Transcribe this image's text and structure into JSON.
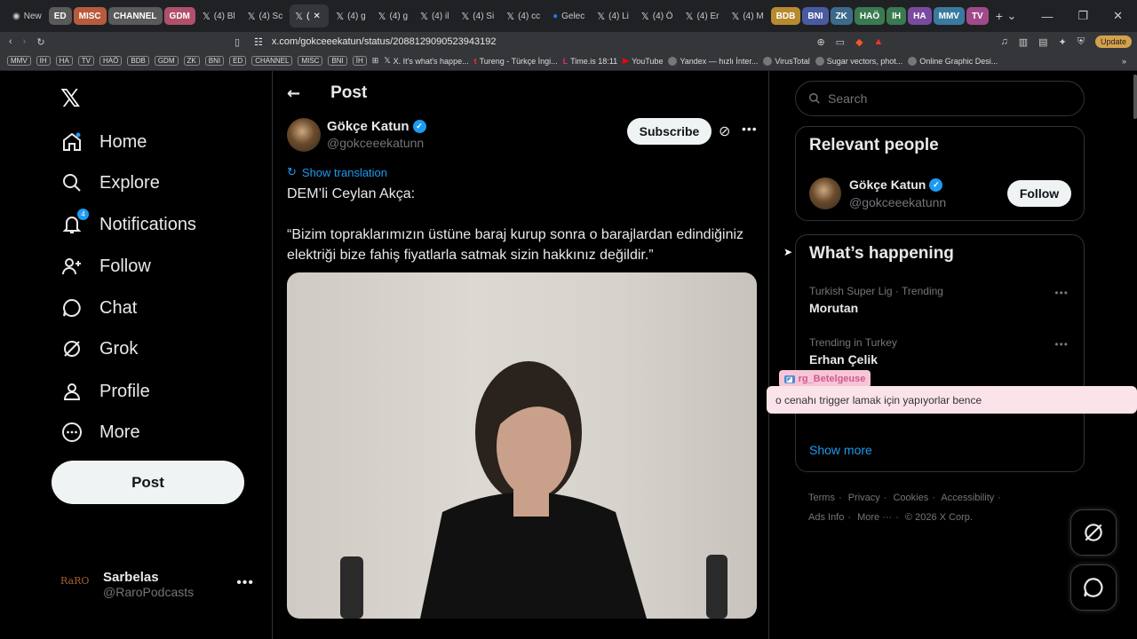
{
  "browser": {
    "tabs": [
      "New",
      "ED",
      "MISC",
      "CHANNEL",
      "GDM",
      "(4) Bl",
      "(4) Sc",
      "(",
      "(4) g",
      "(4) g",
      "(4) il",
      "(4) Si",
      "(4) cc",
      "Gelec",
      "(4) Li",
      "(4) Ö",
      "(4) Er",
      "(4) M",
      "BDB",
      "BNI",
      "ZK",
      "HAÖ",
      "IH",
      "HA",
      "MMV",
      "TV"
    ],
    "tab_group_colors": {
      "ED": "#5a5a5a",
      "MISC": "#b85a3c",
      "CHANNEL": "#5a5a5a",
      "GDM": "#b0506a",
      "BDB": "#b88a30",
      "BNI": "#4a5aa0",
      "ZK": "#3c6a8a",
      "HAÖ": "#3a7a50",
      "IH": "#3a7a50",
      "HA": "#7a4aa0",
      "MMV": "#3a7aa0",
      "TV": "#a04a8a"
    },
    "url": "x.com/gokceeekatun/status/2088129090523943192",
    "update_label": "Update",
    "bookmarks": [
      "MMV",
      "IH",
      "HA",
      "TV",
      "HAÖ",
      "BDB",
      "GDM",
      "ZK",
      "BNI",
      "ED",
      "CHANNEL",
      "MISC",
      "BNI",
      "İH"
    ],
    "bookmark_links": [
      "X. It's what's happe...",
      "Tureng - Türkçe İngi...",
      "Time.is 18:11",
      "YouTube",
      "Yandex — hızlı İnter...",
      "VirusTotal",
      "Sugar vectors, phot...",
      "Online Graphic Desi..."
    ]
  },
  "nav": {
    "items": [
      {
        "label": "Home",
        "icon": "home-icon"
      },
      {
        "label": "Explore",
        "icon": "search-icon"
      },
      {
        "label": "Notifications",
        "icon": "bell-icon",
        "badge": "4"
      },
      {
        "label": "Follow",
        "icon": "person-add-icon"
      },
      {
        "label": "Chat",
        "icon": "chat-icon"
      },
      {
        "label": "Grok",
        "icon": "grok-icon"
      },
      {
        "label": "Profile",
        "icon": "person-icon"
      },
      {
        "label": "More",
        "icon": "more-icon"
      }
    ],
    "post_label": "Post",
    "account": {
      "avatar_text": "RaRO",
      "name": "Sarbelas",
      "handle": "@RaroPodcasts"
    }
  },
  "post": {
    "header": "Post",
    "author_name": "Gökçe Katun",
    "author_handle": "@gokceeekatunn",
    "subscribe_label": "Subscribe",
    "show_translation": "Show translation",
    "text_line1": "DEM’li Ceylan Akça:",
    "text_line2": "“Bizim topraklarımızın üstüne baraj kurup sonra o barajlardan edindiğiniz elektriği bize fahiş fiyatlarla satmak sizin hakkınız değildir.”"
  },
  "sidebar": {
    "search_placeholder": "Search",
    "relevant_title": "Relevant people",
    "relevant_name": "Gökçe Katun",
    "relevant_handle": "@gokceeekatunn",
    "follow_label": "Follow",
    "happening_title": "What’s happening",
    "trends": [
      {
        "meta": "Turkish Super Lig · Trending",
        "name": "Morutan"
      },
      {
        "meta": "Trending in Turkey",
        "name": "Erhan Çelik"
      }
    ],
    "show_more": "Show more",
    "footer": [
      "Terms",
      "Privacy",
      "Cookies",
      "Accessibility",
      "Ads Info",
      "More ···",
      "© 2026 X Corp."
    ]
  },
  "overlay": {
    "user": "rg_Betelgeuse",
    "message": "o cenahı trigger lamak için yapıyorlar bence"
  }
}
